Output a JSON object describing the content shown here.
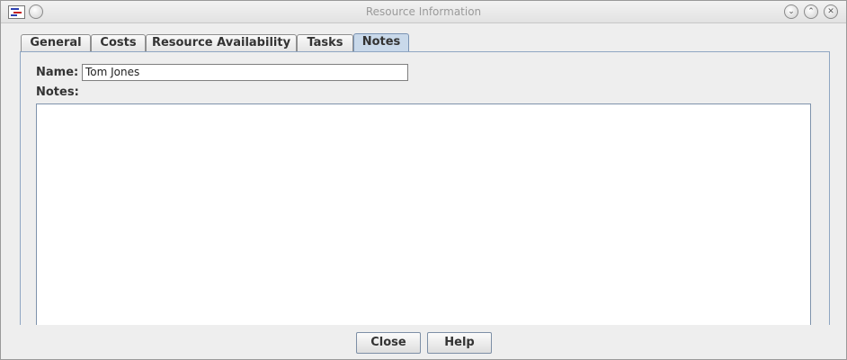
{
  "window": {
    "title": "Resource Information"
  },
  "titlebar": {
    "menu_icon": "circle-icon",
    "minimize_icon": "chevron-down-icon",
    "maximize_icon": "chevron-up-icon",
    "close_icon": "close-icon"
  },
  "tabs": [
    {
      "label": "General",
      "selected": false
    },
    {
      "label": "Costs",
      "selected": false
    },
    {
      "label": "Resource Availability",
      "selected": false
    },
    {
      "label": "Tasks",
      "selected": false
    },
    {
      "label": "Notes",
      "selected": true
    }
  ],
  "form": {
    "name_label": "Name:",
    "name_value": "Tom Jones",
    "notes_label": "Notes:",
    "notes_value": ""
  },
  "buttons": {
    "close_label": "Close",
    "help_label": "Help"
  },
  "colors": {
    "selected_tab": "#c9d9ea",
    "panel_border": "#8fa6c2"
  }
}
